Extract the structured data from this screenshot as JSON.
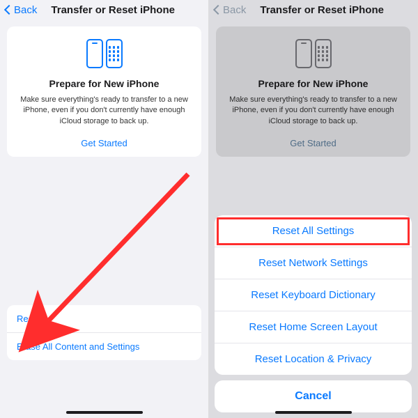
{
  "nav": {
    "back": "Back",
    "title": "Transfer or Reset iPhone"
  },
  "card": {
    "title": "Prepare for New iPhone",
    "desc": "Make sure everything's ready to transfer to a new iPhone, even if you don't currently have enough iCloud storage to back up.",
    "cta": "Get Started"
  },
  "left_list": {
    "reset": "Reset",
    "erase": "Erase All Content and Settings"
  },
  "sheet": {
    "items": [
      "Reset All Settings",
      "Reset Network Settings",
      "Reset Keyboard Dictionary",
      "Reset Home Screen Layout",
      "Reset Location & Privacy"
    ],
    "cancel": "Cancel"
  },
  "colors": {
    "accent": "#0a7aff",
    "highlight": "#ff2d2d"
  }
}
